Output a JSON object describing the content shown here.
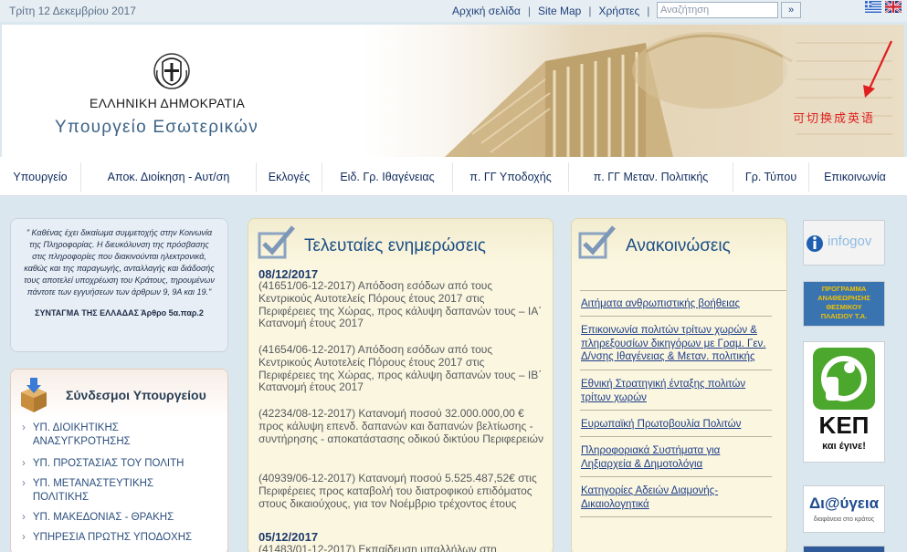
{
  "topbar": {
    "date": "Τρίτη 12 Δεκεμβρίου 2017",
    "links": [
      "Αρχική σελίδα",
      "Site Map",
      "Χρήστες"
    ],
    "search_placeholder": "Αναζήτηση",
    "go_label": "»",
    "flags": [
      "greek-flag-icon",
      "uk-flag-icon"
    ]
  },
  "header": {
    "republic": "ΕΛΛΗΝΙΚΗ ΔΗΜΟΚΡΑΤΙΑ",
    "ministry": "Υπουργείο Εσωτερικών",
    "annotation": "可切换成英语",
    "annotation_color": "#e02020"
  },
  "nav": [
    "Υπουργείο",
    "Αποκ. Διοίκηση - Αυτ/ση",
    "Εκλογές",
    "Ειδ. Γρ. Ιθαγένειας",
    "π. ΓΓ Υποδοχής",
    "π. ΓΓ Μεταν. Πολιτικής",
    "Γρ. Τύπου",
    "Επικοινωνία"
  ],
  "quote": {
    "text": "\" Καθένας έχει δικαίωμα συμμετοχής στην Κοινωνία της Πληροφορίας. Η διευκόλυνση της πρόσβασης στις πληροφορίες που διακινούνται ηλεκτρονικά, καθώς και της παραγωγής, ανταλλαγής και διάδοσής τους αποτελεί υποχρέωση του Κράτους, τηρουμένων πάντοτε των εγγυήσεων των άρθρων 9, 9Α και 19.\"",
    "source": "ΣΥΝΤΑΓΜΑ ΤΗΣ ΕΛΛΑΔΑΣ Άρθρο 5α.παρ.2"
  },
  "links": {
    "title": "Σύνδεσμοι Υπουργείου",
    "items": [
      "ΥΠ. ΔΙΟΙΚΗΤΙΚΗΣ ΑΝΑΣΥΓΚΡΟΤΗΣΗΣ",
      "ΥΠ. ΠΡΟΣΤΑΣΙΑΣ ΤΟΥ ΠΟΛΙΤΗ",
      "ΥΠ. ΜΕΤΑΝΑΣΤΕΥΤΙΚΗΣ ΠΟΛΙΤΙΚΗΣ",
      "ΥΠ. ΜΑΚΕΔΟΝΙΑΣ - ΘΡΑΚΗΣ",
      "ΥΠΗΡΕΣΙΑ ΠΡΩΤΗΣ ΥΠΟΔΟΧΗΣ"
    ]
  },
  "news": {
    "title": "Τελευταίες ενημερώσεις",
    "date1": "08/12/2017",
    "items": [
      "(41651/06-12-2017) Απόδοση εσόδων από τους Κεντρικούς Αυτοτελείς Πόρους έτους 2017 στις Περιφέρειες της Χώρας, προς κάλυψη δαπανών τους – ΙΑ΄ Κατανομή έτους 2017",
      "(41654/06-12-2017) Απόδοση εσόδων από τους Κεντρικούς Αυτοτελείς Πόρους έτους 2017 στις Περιφέρειες της Χώρας, προς κάλυψη δαπανών τους – ΙΒ΄ Κατανομή έτους 2017",
      "(42234/08-12-2017) Κατανομή ποσού 32.000.000,00 € προς κάλυψη επενδ. δαπανών και δαπανών βελτίωσης - συντήρησης - αποκατάστασης οδικού δικτύου Περιφερειών",
      "(40939/06-12-2017) Κατανομή ποσού 5.525.487,52€ στις Περιφέρειες προς καταβολή του διατροφικού επιδόματος στους δικαιούχους, για τον Νοέμβριο τρέχοντος έτους"
    ],
    "date2": "05/12/2017",
    "item_last": "(41483/01-12-2017) Εκπαίδευση υπαλλήλων στη"
  },
  "announcements": {
    "title": "Ανακοινώσεις",
    "items": [
      "Αιτήματα ανθρωπιστικής βοήθειας",
      "Επικοινωνία πολιτών τρίτων χωρών & πληρεξουσίων δικηγόρων με Γραμ. Γεν. Δ/νσης Ιθαγένειας & Μεταν. πολιτικής",
      "Εθνική Στρατηγική ένταξης πολιτών τρίτων χωρών",
      "Ευρωπαϊκή Πρωτοβουλία Πολιτών",
      "Πληροφοριακά Συστήματα για Ληξιαρχεία & Δημοτολόγια",
      "Κατηγορίες Αδειών Διαμονής-Δικαιολογητικά"
    ]
  },
  "banners": {
    "infogov": "infogov",
    "programme": [
      "ΠΡΟΓΡΑΜΜΑ",
      "ΑΝΑΘΕΩΡΗΣΗΣ",
      "ΘΕΣΜΙΚΟΥ",
      "ΠΛΑΙΣΙΟΥ Τ.Α."
    ],
    "kep": "ΚΕΠ",
    "kep_sub": "και έγινε!",
    "diavgeia": "Δι@ύγεια",
    "diavgeia_sub": "διαφάνεια στο κράτος"
  }
}
